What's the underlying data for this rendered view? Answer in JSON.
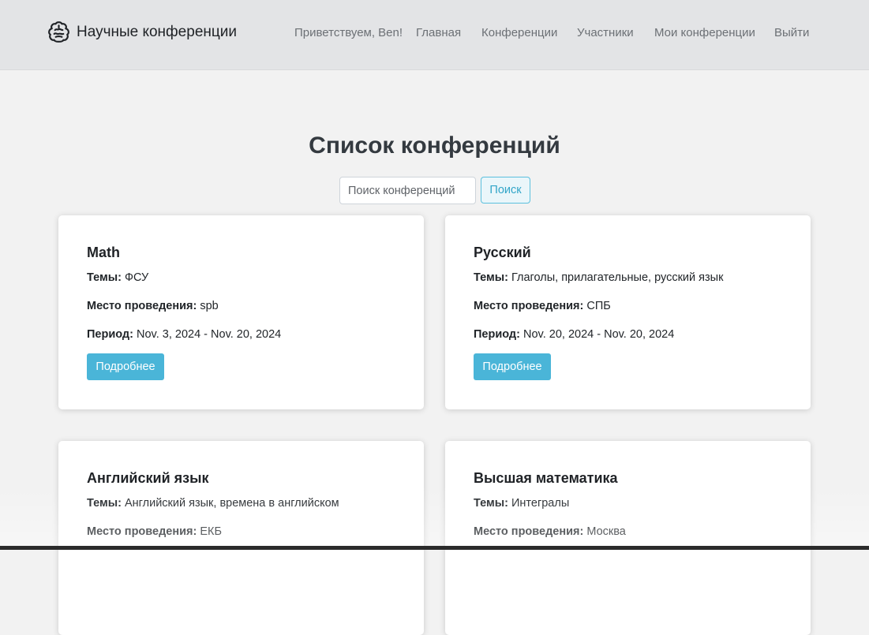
{
  "navbar": {
    "brand": "Научные конференции",
    "greeting": "Приветствуем, Ben!",
    "links": [
      "Главная",
      "Конференции",
      "Участники",
      "Мои конференции",
      "Выйти"
    ]
  },
  "main": {
    "title": "Список конференций",
    "search": {
      "placeholder": "Поиск конференций",
      "value": "",
      "button_label": "Поиск"
    }
  },
  "labels": {
    "topics": "Темы:",
    "venue": "Место проведения:",
    "period": "Период:",
    "details": "Подробнее"
  },
  "conferences": [
    {
      "title": "Math",
      "topics": "ФСУ",
      "venue": "spb",
      "period": "Nov. 3, 2024 - Nov. 20, 2024"
    },
    {
      "title": "Русский",
      "topics": "Глаголы, прилагательные, русский язык",
      "venue": "СПБ",
      "period": "Nov. 20, 2024 - Nov. 20, 2024"
    },
    {
      "title": "Английский язык",
      "topics": "Английский язык, времена в английском",
      "venue": "ЕКБ"
    },
    {
      "title": "Высшая математика",
      "topics": "Интегралы",
      "venue": "Москва"
    }
  ]
}
